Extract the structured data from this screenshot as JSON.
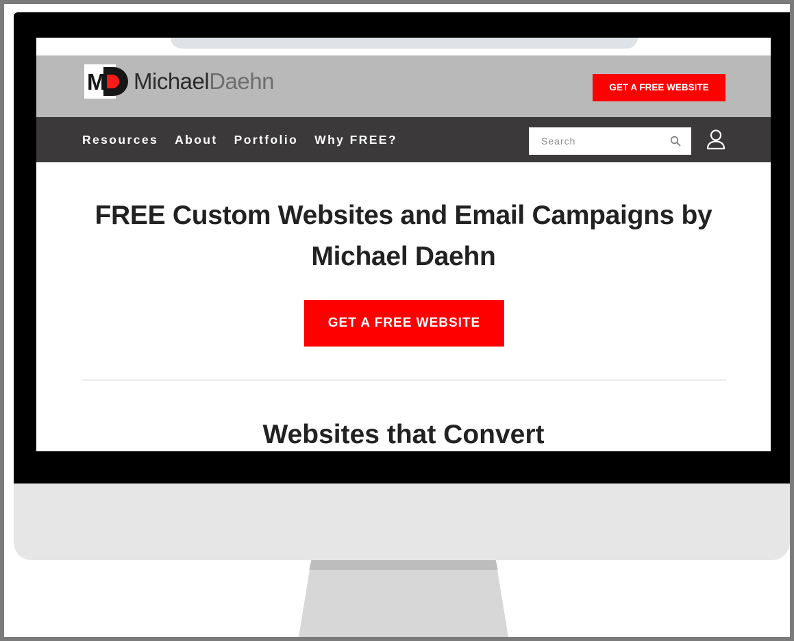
{
  "brand": {
    "first_name": "Michael",
    "last_name": "Daehn",
    "mark_letters": "M",
    "accent_color": "#ff0000"
  },
  "header": {
    "cta_label": "GET A FREE WEBSITE"
  },
  "nav": {
    "items": [
      {
        "label": "Resources"
      },
      {
        "label": "About"
      },
      {
        "label": "Portfolio"
      },
      {
        "label": "Why FREE?"
      }
    ],
    "search_placeholder": "Search",
    "search_icon": "search-icon",
    "account_icon": "user-icon"
  },
  "hero": {
    "title": "FREE Custom Websites and Email Campaigns by Michael Daehn",
    "cta_label": "GET A FREE WEBSITE"
  },
  "section": {
    "title": "Websites that Convert"
  }
}
